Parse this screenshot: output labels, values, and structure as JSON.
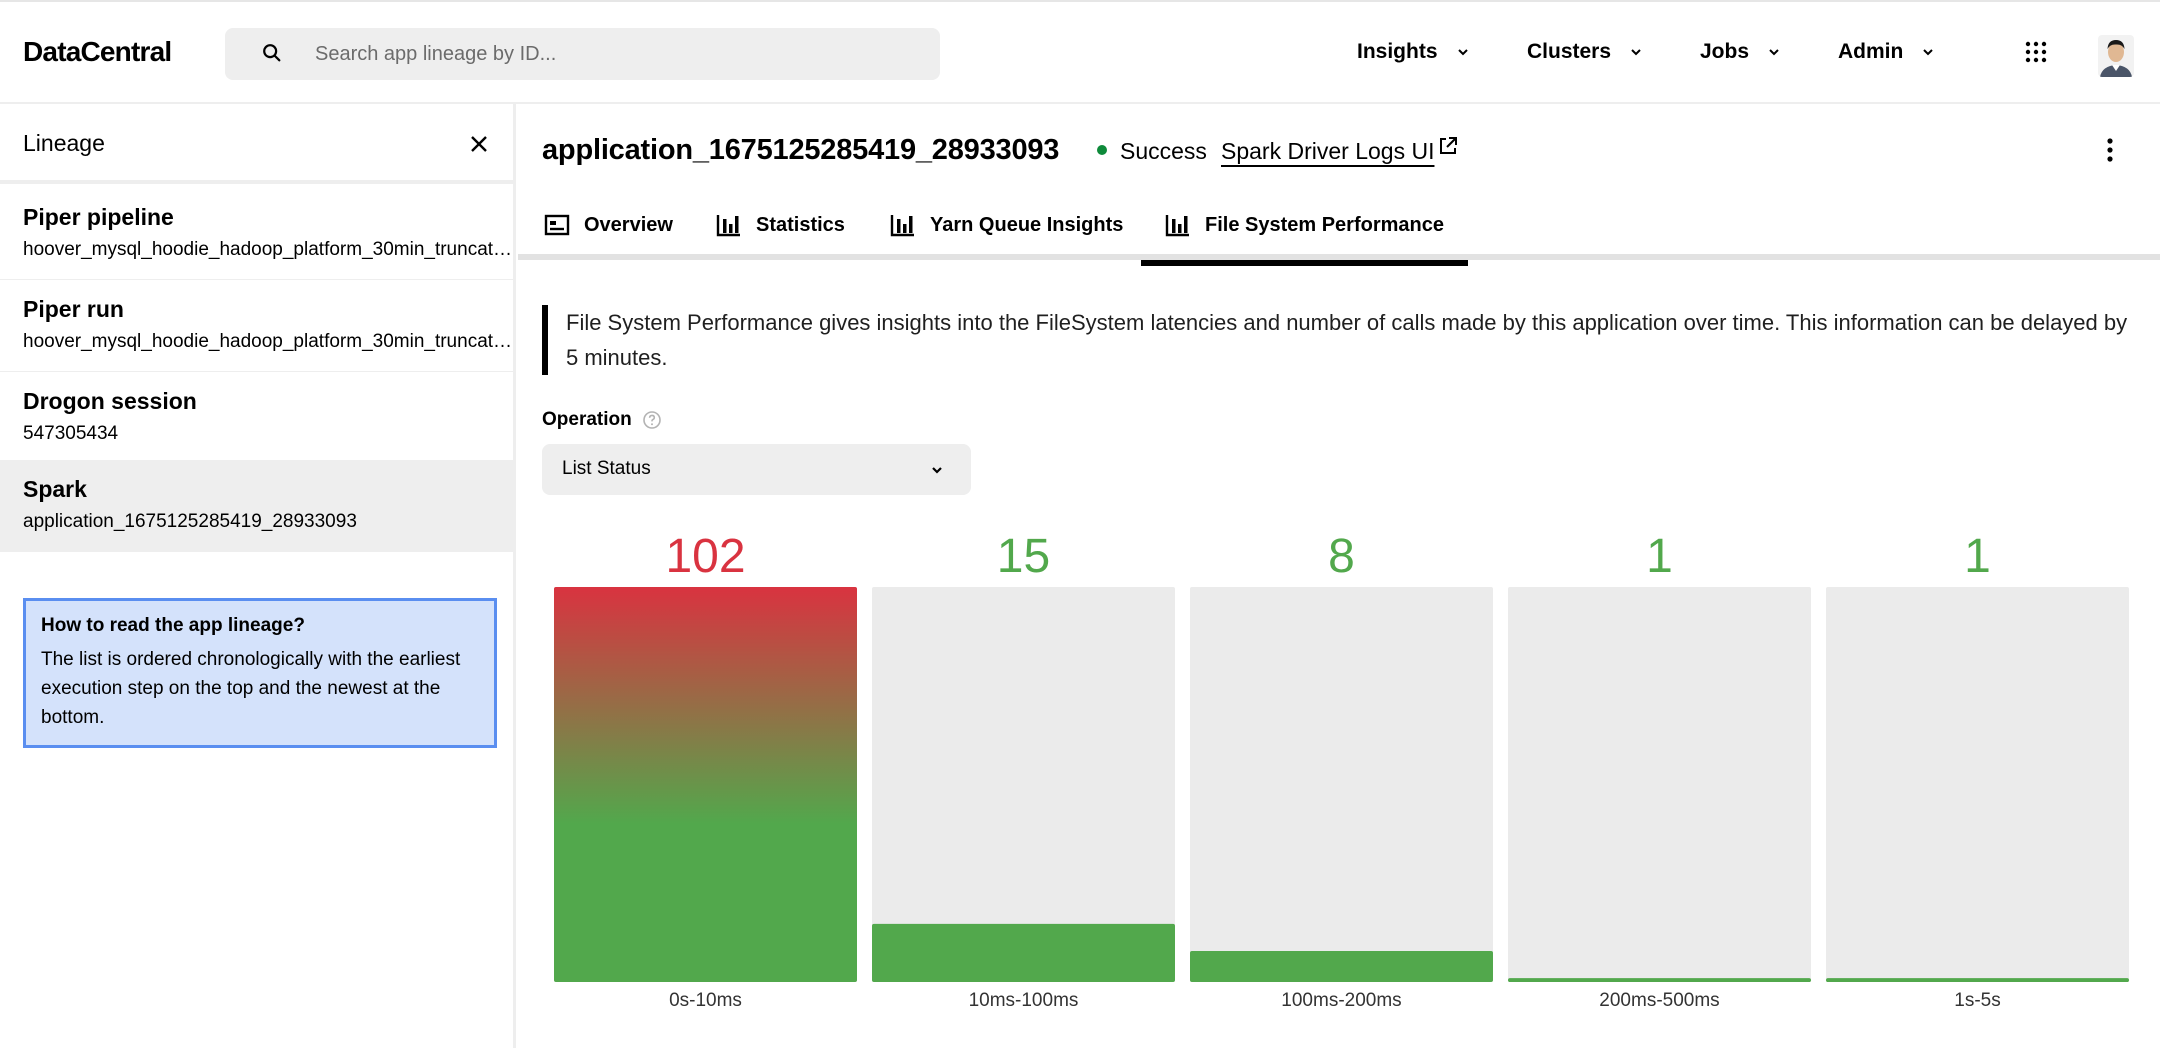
{
  "app": {
    "name": "DataCentral"
  },
  "search": {
    "placeholder": "Search app lineage by ID..."
  },
  "nav": {
    "insights": "Insights",
    "clusters": "Clusters",
    "jobs": "Jobs",
    "admin": "Admin"
  },
  "sidebar": {
    "title": "Lineage",
    "items": [
      {
        "title": "Piper pipeline",
        "subtitle": "hoover_mysql_hoodie_hadoop_platform_30min_truncated"
      },
      {
        "title": "Piper run",
        "subtitle": "hoover_mysql_hoodie_hadoop_platform_30min_truncated"
      },
      {
        "title": "Drogon session",
        "subtitle": "547305434"
      },
      {
        "title": "Spark",
        "subtitle": "application_1675125285419_28933093"
      }
    ],
    "help": {
      "title": "How to read the app lineage?",
      "text": "The list is ordered chronologically with the earliest execution step on the top and the newest at the bottom."
    }
  },
  "main": {
    "app_id": "application_1675125285419_28933093",
    "status": "Success",
    "status_color": "#0e8a3a",
    "driver_link": "Spark Driver Logs UI",
    "tabs": [
      {
        "label": "Overview"
      },
      {
        "label": "Statistics"
      },
      {
        "label": "Yarn Queue Insights"
      },
      {
        "label": "File System Performance"
      }
    ],
    "active_tab": "File System Performance",
    "info": "File System Performance gives insights into the FileSystem latencies and number of calls made by this application over time. This information can be delayed by 5 minutes.",
    "operation_label": "Operation",
    "operation_value": "List Status"
  },
  "chart_data": {
    "type": "bar",
    "categories": [
      "0s-10ms",
      "10ms-100ms",
      "100ms-200ms",
      "200ms-500ms",
      "1s-5s"
    ],
    "values": [
      102,
      15,
      8,
      1,
      1
    ],
    "ylim": [
      0,
      102
    ],
    "colors": {
      "high": "#d93340",
      "normal": "#52a84c",
      "track": "#ebebeb"
    },
    "value_label_colors": [
      "#d93340",
      "#52a84c",
      "#52a84c",
      "#52a84c",
      "#52a84c"
    ]
  }
}
